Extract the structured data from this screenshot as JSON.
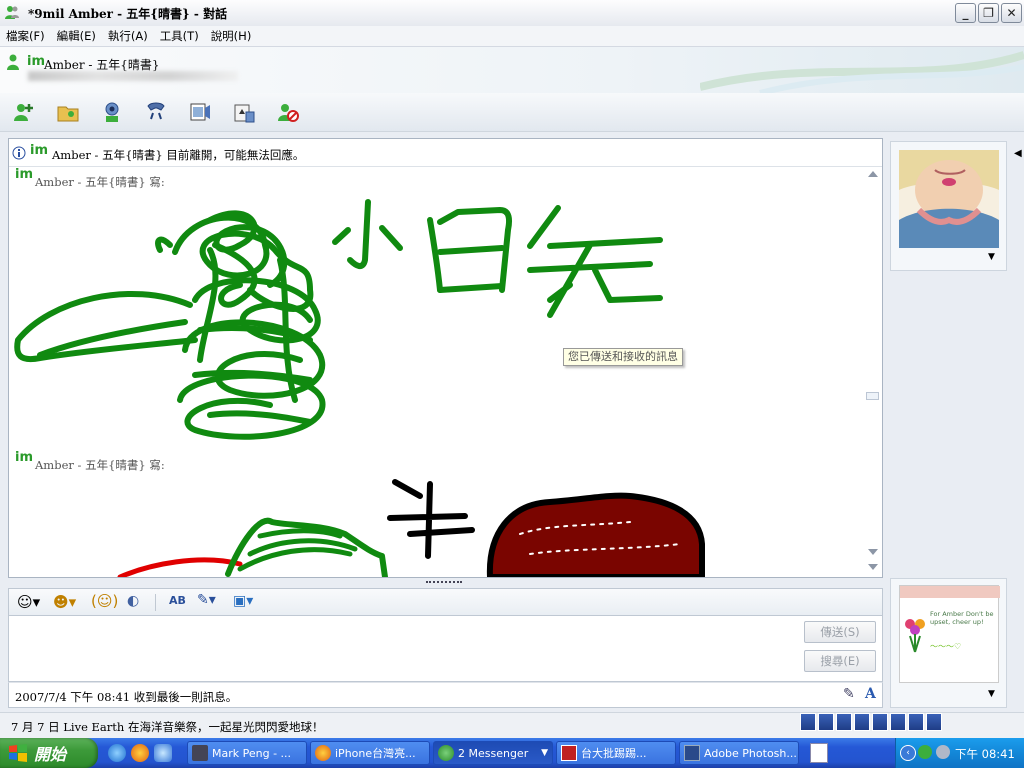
{
  "window": {
    "title": "*9mil Amber - 五年{晴書} - 對話",
    "minimize_label": "_",
    "restore_label": "❐",
    "close_label": "✕"
  },
  "menu": [
    "檔案(F)",
    "編輯(E)",
    "執行(A)",
    "工具(T)",
    "說明(H)"
  ],
  "header": {
    "contact_name": "Amber - 五年{晴書}"
  },
  "toolbar_icons": [
    "invite-contact-icon",
    "share-folder-icon",
    "video-call-icon",
    "phone-call-icon",
    "video-clip-icon",
    "games-icon",
    "block-contact-icon"
  ],
  "conversation": {
    "info_text": "Amber - 五年{晴書} 目前離開，可能無法回應。",
    "messages": [
      {
        "sender": "Amber - 五年{晴書} 寫:",
        "drawing_text": "小白菜"
      },
      {
        "sender": "Amber - 五年{晴書} 寫:",
        "drawing_text": "牛"
      }
    ],
    "tooltip": "您已傳送和接收的訊息"
  },
  "compose": {
    "send_label": "傳送(S)",
    "search_label": "搜尋(E)"
  },
  "status": {
    "last_message": "2007/7/4 下午 08:41 收到最後一則訊息。"
  },
  "right_pane": {
    "picture_text": "For Amber Don't be upset, cheer up!"
  },
  "ticker": {
    "text": "7 月 7 日 Live Earth 在海洋音樂祭，一起星光閃閃愛地球！"
  },
  "taskbar": {
    "start_label": "開始",
    "tasks": [
      {
        "label": "Mark Peng - ..."
      },
      {
        "label": "iPhone台灣亮..."
      },
      {
        "label": "2 Messenger"
      },
      {
        "label": "台大批踢踢..."
      },
      {
        "label": "Adobe Photosh..."
      }
    ],
    "clock": "下午 08:41"
  },
  "colors": {
    "drawing_green": "#108a10",
    "drawing_red": "#e00000",
    "drawing_dark_red": "#7a0500",
    "taskbar_blue": "#2454cf",
    "start_green": "#3d9a3a"
  }
}
